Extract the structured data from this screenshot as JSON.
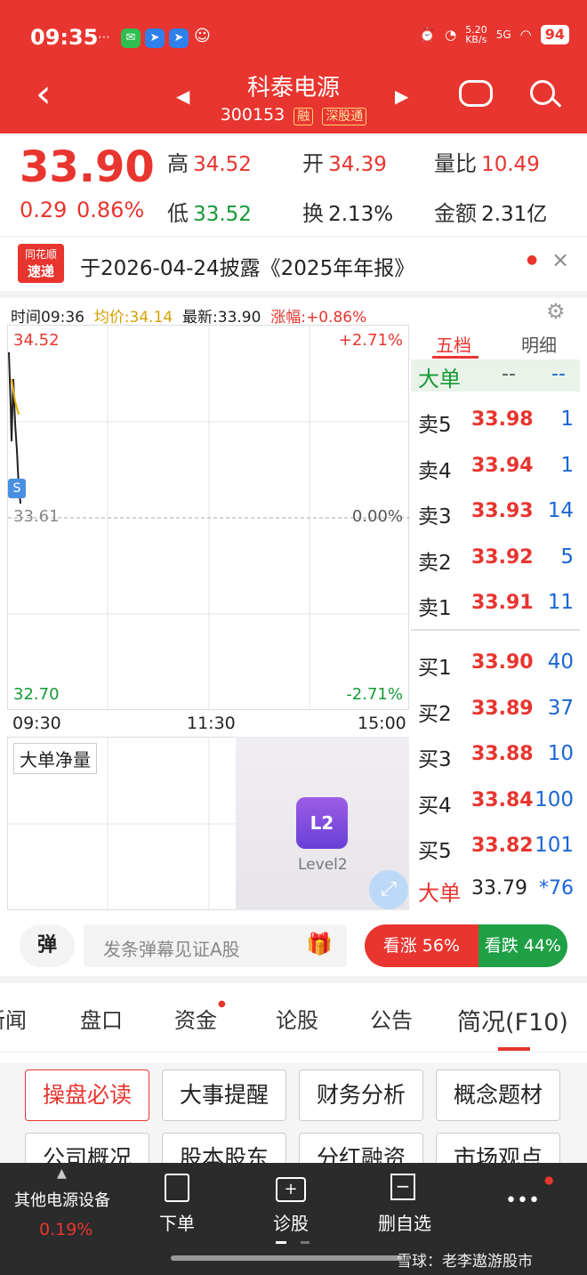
{
  "status": {
    "time": "09:35",
    "net": "5.20\nKB/s",
    "signal": "5G",
    "battery": "94"
  },
  "header": {
    "title": "科泰电源",
    "code": "300153",
    "tag1": "融",
    "tag2": "深股通"
  },
  "quote": {
    "price": "33.90",
    "chg": "0.29",
    "pct": "0.86%",
    "high_l": "高",
    "high": "34.52",
    "open_l": "开",
    "open": "34.39",
    "vr_l": "量比",
    "vr": "10.49",
    "low_l": "低",
    "low": "33.52",
    "tr_l": "换",
    "tr": "2.13%",
    "amt_l": "金额",
    "amt": "2.31亿"
  },
  "news": {
    "logo1": "同花顺",
    "logo2": "速递",
    "text": "于2026-04-24披露《2025年年报》"
  },
  "chart": {
    "time": "时间09:36",
    "avg": "均价:34.14",
    "last": "最新:33.90",
    "chg": "涨幅:+0.86%",
    "ymax": "34.52",
    "ymin": "32.70",
    "base": "33.61",
    "pmax": "+2.71%",
    "pmin": "-2.71%",
    "pzero": "0.00%",
    "t1": "09:30",
    "t2": "11:30",
    "t3": "15:00",
    "marker": "S",
    "sub_label": "大单净量",
    "l2_label": "Level2",
    "l2_icon": "L2"
  },
  "book": {
    "tab1": "五档",
    "tab2": "明细",
    "big": "大单",
    "bigv1": "--",
    "bigv2": "--",
    "asks": [
      {
        "n": "卖5",
        "p": "33.98",
        "v": "1"
      },
      {
        "n": "卖4",
        "p": "33.94",
        "v": "1"
      },
      {
        "n": "卖3",
        "p": "33.93",
        "v": "14"
      },
      {
        "n": "卖2",
        "p": "33.92",
        "v": "5"
      },
      {
        "n": "卖1",
        "p": "33.91",
        "v": "11"
      }
    ],
    "bids": [
      {
        "n": "买1",
        "p": "33.90",
        "v": "40"
      },
      {
        "n": "买2",
        "p": "33.89",
        "v": "37"
      },
      {
        "n": "买3",
        "p": "33.88",
        "v": "10"
      },
      {
        "n": "买4",
        "p": "33.84",
        "v": "100"
      },
      {
        "n": "买5",
        "p": "33.82",
        "v": "101"
      }
    ],
    "big2": "大单",
    "big2p": "33.79",
    "big2v": "*76"
  },
  "danmu": {
    "icon": "弹",
    "placeholder": "发条弹幕见证A股",
    "up": "看涨 56%",
    "down": "看跌 44%",
    "up_pct": 56
  },
  "tabs": [
    "新闻",
    "盘口",
    "资金",
    "论股",
    "公告",
    "简况(F10)"
  ],
  "buttons": [
    "操盘必读",
    "大事提醒",
    "财务分析",
    "概念题材",
    "公司概况",
    "股本股东",
    "分红融资",
    "市场观点"
  ],
  "bottom": {
    "sector": "其他电源设备",
    "sector_pct": "0.19%",
    "b1": "下单",
    "b2": "诊股",
    "b3": "删自选",
    "more": "•••",
    "watermark": "雪球：老李遨游股市"
  }
}
